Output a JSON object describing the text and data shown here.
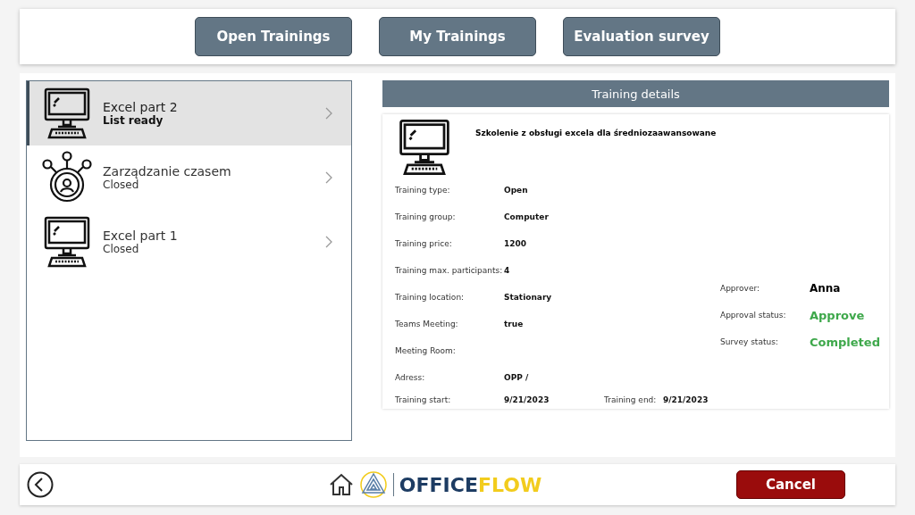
{
  "nav_buttons": [
    "Open Trainings",
    "My Trainings",
    "Evaluation survey"
  ],
  "trainings": [
    {
      "name": "Excel part 2",
      "status": "List ready",
      "kind": "computer",
      "selected": true
    },
    {
      "name": "Zarządzanie czasem",
      "status": "Closed",
      "kind": "people",
      "selected": false
    },
    {
      "name": "Excel part 1",
      "status": "Closed",
      "kind": "computer",
      "selected": false
    }
  ],
  "details": {
    "header": "Training details",
    "title": "Szkolenie z obsługi excela dla średniozaawansowane",
    "fields": [
      {
        "label": "Training type:",
        "value": "Open"
      },
      {
        "label": "Training group:",
        "value": "Computer"
      },
      {
        "label": "Training price:",
        "value": "1200"
      },
      {
        "label": "Training max. participants:",
        "value": "4"
      },
      {
        "label": "Training location:",
        "value": "Stationary"
      },
      {
        "label": "Teams Meeting:",
        "value": "true"
      },
      {
        "label": "Meeting Room:"
      },
      {
        "label": "Adress:",
        "value": "OPP /"
      }
    ],
    "start_label": "Training start:",
    "start": "9/21/2023",
    "end_label": "Training end:",
    "end": "9/21/2023",
    "approval": [
      {
        "label": "Approver:",
        "value": "Anna",
        "kind": "name"
      },
      {
        "label": "Approval status:",
        "value": "Approve",
        "kind": "status"
      },
      {
        "label": "Survey status:",
        "value": "Completed",
        "kind": "status"
      }
    ]
  },
  "footer": {
    "logo_first": "OFFICE",
    "logo_second": "FLOW",
    "cancel": "Cancel"
  }
}
